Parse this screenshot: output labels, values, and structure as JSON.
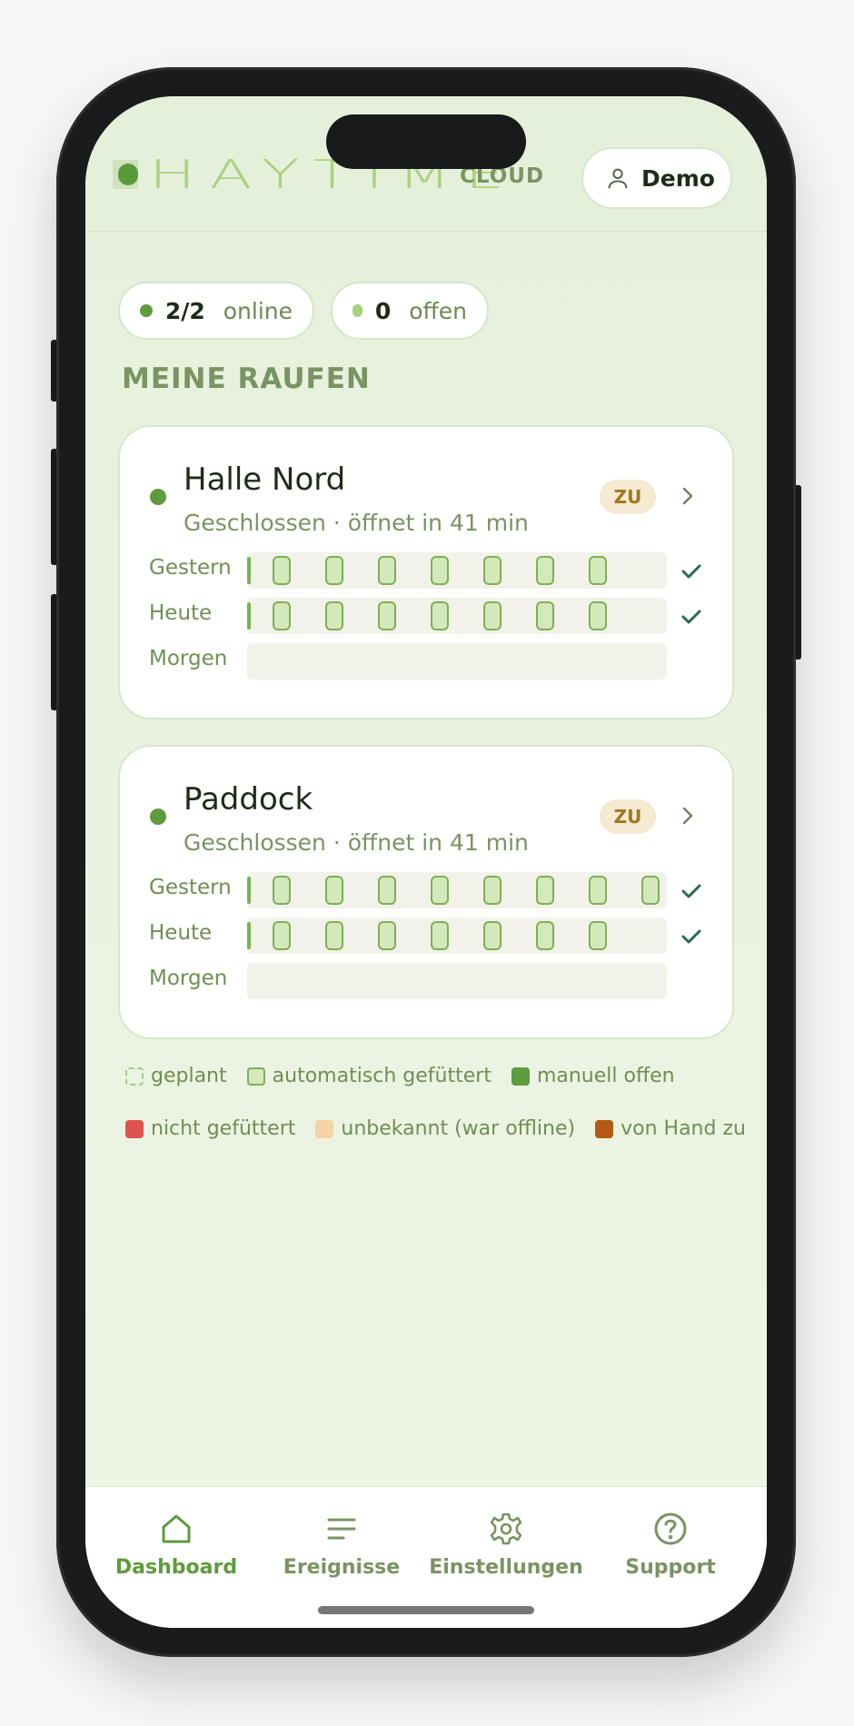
{
  "header": {
    "logo_text": "HAYTIME",
    "logo_suffix": "CLOUD",
    "user_label": "Demo"
  },
  "stats": [
    {
      "value": "2/2",
      "label": "online",
      "dot_color": "#5e9b3c"
    },
    {
      "value": "0",
      "label": "offen",
      "dot_color": "#a6d07c"
    }
  ],
  "section_title": "MEINE RAUFEN",
  "cards": [
    {
      "name": "Halle Nord",
      "status": "Geschlossen · öffnet in 41 min",
      "badge": "ZU",
      "rows": [
        {
          "label": "Gestern",
          "slots": 7,
          "checked": true
        },
        {
          "label": "Heute",
          "slots": 7,
          "checked": true
        },
        {
          "label": "Morgen",
          "slots": 0,
          "checked": false
        }
      ]
    },
    {
      "name": "Paddock",
      "status": "Geschlossen · öffnet in 41 min",
      "badge": "ZU",
      "rows": [
        {
          "label": "Gestern",
          "slots": 8,
          "checked": true
        },
        {
          "label": "Heute",
          "slots": 7,
          "checked": true
        },
        {
          "label": "Morgen",
          "slots": 0,
          "checked": false
        }
      ]
    }
  ],
  "legend": [
    {
      "label": "geplant",
      "style": "dashed",
      "color": "#a6c98a"
    },
    {
      "label": "automatisch gefüttert",
      "style": "fill",
      "color": "#d3e9bc"
    },
    {
      "label": "manuell offen",
      "style": "fill",
      "color": "#5e9b3c"
    },
    {
      "label": "nicht gefüttert",
      "style": "fill",
      "color": "#e05252"
    },
    {
      "label": "unbekannt (war offline)",
      "style": "fill",
      "color": "#f6d3a4"
    },
    {
      "label": "von Hand zu",
      "style": "fill",
      "color": "#b25a12"
    }
  ],
  "nav": [
    {
      "label": "Dashboard",
      "icon": "home-icon",
      "active": true
    },
    {
      "label": "Ereignisse",
      "icon": "list-icon",
      "active": false
    },
    {
      "label": "Einstellungen",
      "icon": "gear-icon",
      "active": false
    },
    {
      "label": "Support",
      "icon": "help-icon",
      "active": false
    }
  ]
}
